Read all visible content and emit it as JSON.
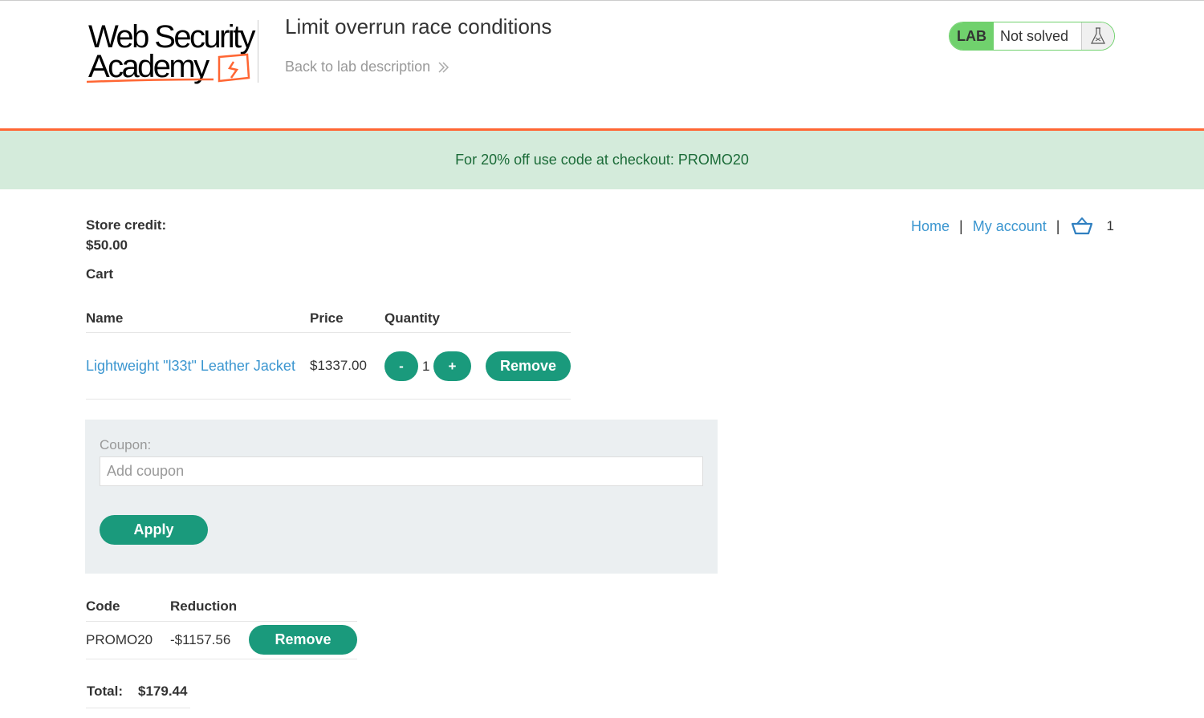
{
  "header": {
    "logo_line1": "Web Security",
    "logo_line2": "Academy",
    "lab_title": "Limit overrun race conditions",
    "back_link": "Back to lab description",
    "lab_badge": "LAB",
    "lab_status": "Not solved"
  },
  "banner": {
    "text": "For 20% off use code at checkout: PROMO20"
  },
  "account": {
    "store_credit_label": "Store credit:",
    "store_credit_value": "$50.00"
  },
  "nav": {
    "home": "Home",
    "separator": "|",
    "my_account": "My account",
    "cart_count": "1"
  },
  "cart": {
    "heading": "Cart",
    "columns": [
      "Name",
      "Price",
      "Quantity"
    ],
    "items": [
      {
        "name": "Lightweight \"l33t\" Leather Jacket",
        "price": "$1337.00",
        "quantity": "1",
        "decrease_label": "-",
        "increase_label": "+",
        "remove_label": "Remove"
      }
    ]
  },
  "coupon": {
    "label": "Coupon:",
    "placeholder": "Add coupon",
    "apply_label": "Apply"
  },
  "applied_codes": {
    "columns": [
      "Code",
      "Reduction"
    ],
    "rows": [
      {
        "code": "PROMO20",
        "reduction": "-$1157.56",
        "remove_label": "Remove"
      }
    ]
  },
  "total": {
    "label": "Total:",
    "value": "$179.44"
  },
  "colors": {
    "accent_green": "#1a9a7c",
    "lab_green": "#70d16d",
    "link_blue": "#3b96d0",
    "orange": "#ff6633",
    "banner_bg": "#d4ebdb"
  }
}
